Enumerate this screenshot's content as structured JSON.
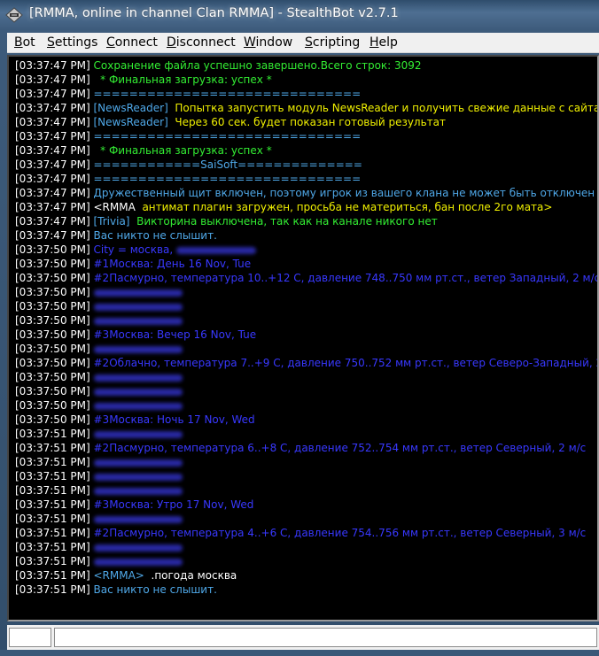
{
  "window": {
    "title": "[RMMA, online in channel Clan RMMA] - StealthBot v2.7.1"
  },
  "menu": [
    {
      "mnemonic": "B",
      "rest": "ot"
    },
    {
      "mnemonic": "S",
      "rest": "ettings"
    },
    {
      "mnemonic": "C",
      "rest": "onnect"
    },
    {
      "mnemonic": "D",
      "rest": "isconnect"
    },
    {
      "mnemonic": "W",
      "rest": "indow"
    },
    {
      "mnemonic": "S",
      "rest": "cripting"
    },
    {
      "mnemonic": "H",
      "rest": "elp"
    }
  ],
  "colors": {
    "green": "#33ee33",
    "yellow": "#f0f000",
    "cyan": "#4fa8e8",
    "blue": "#3838ff",
    "white": "#ffffff"
  },
  "chat": [
    {
      "ts": "[03:37:47 PM]",
      "parts": [
        {
          "t": "Сохранение файла успешно завершено.Всего строк: 3092",
          "c": "green"
        }
      ]
    },
    {
      "ts": "[03:37:47 PM]",
      "parts": [
        {
          "t": "  * Финальная загрузка: успех *",
          "c": "green"
        }
      ]
    },
    {
      "ts": "[03:37:47 PM]",
      "parts": [
        {
          "t": "==============================",
          "c": "cyan"
        }
      ]
    },
    {
      "ts": "[03:37:47 PM]",
      "parts": [
        {
          "t": "[NewsReader]",
          "c": "cyan"
        },
        {
          "t": "  Попытка запустить модуль NewsReader и получить свежие данные с сайта",
          "c": "yellow"
        }
      ]
    },
    {
      "ts": "[03:37:47 PM]",
      "parts": [
        {
          "t": "[NewsReader]",
          "c": "cyan"
        },
        {
          "t": "  Через 60 сек. будет показан готовый результат",
          "c": "yellow"
        }
      ]
    },
    {
      "ts": "[03:37:47 PM]",
      "parts": [
        {
          "t": "==============================",
          "c": "cyan"
        }
      ]
    },
    {
      "ts": "[03:37:47 PM]",
      "parts": [
        {
          "t": "  * Финальная загрузка: успех *",
          "c": "green"
        }
      ]
    },
    {
      "ts": "[03:37:47 PM]",
      "parts": [
        {
          "t": "============SaiSoft==============",
          "c": "cyan"
        }
      ]
    },
    {
      "ts": "[03:37:47 PM]",
      "parts": [
        {
          "t": "==============================",
          "c": "cyan"
        }
      ]
    },
    {
      "ts": "[03:37:47 PM]",
      "parts": [
        {
          "t": "Дружественный щит включен, поэтому игрок из вашего клана не может быть отключен с канала",
          "c": "cyan"
        }
      ]
    },
    {
      "ts": "[03:37:47 PM]",
      "parts": [
        {
          "t": "<RMMA  ",
          "c": "white"
        },
        {
          "t": "антимат плагин загружен, просьба не материться, бан после 2го мата>",
          "c": "yellow"
        }
      ]
    },
    {
      "ts": "[03:37:47 PM]",
      "parts": [
        {
          "t": "[Trivia]",
          "c": "cyan"
        },
        {
          "t": "  Викторина выключена, так как на канале никого нет",
          "c": "green"
        }
      ]
    },
    {
      "ts": "[03:37:47 PM]",
      "parts": [
        {
          "t": "Вас никто не слышит.",
          "c": "cyan"
        }
      ]
    },
    {
      "ts": "[03:37:50 PM]",
      "parts": [
        {
          "t": "City = москва, ",
          "c": "blue"
        }
      ],
      "blur": 90
    },
    {
      "ts": "[03:37:50 PM]",
      "parts": [
        {
          "t": "#1Москва: День 16 Nov, Tue",
          "c": "blue"
        }
      ]
    },
    {
      "ts": "[03:37:50 PM]",
      "parts": [
        {
          "t": "#2Пасмурно, температура 10..+12 С, давление 748..750 мм рт.ст., ветер Западный, 2 м/с",
          "c": "blue"
        }
      ]
    },
    {
      "ts": "[03:37:50 PM]",
      "parts": [],
      "blur": 100
    },
    {
      "ts": "[03:37:50 PM]",
      "parts": [],
      "blur": 100
    },
    {
      "ts": "[03:37:50 PM]",
      "parts": [],
      "blur": 100
    },
    {
      "ts": "[03:37:50 PM]",
      "parts": [
        {
          "t": "#3Москва: Вечер 16 Nov, Tue",
          "c": "blue"
        }
      ]
    },
    {
      "ts": "[03:37:50 PM]",
      "parts": [],
      "blur": 100
    },
    {
      "ts": "[03:37:50 PM]",
      "parts": [
        {
          "t": "#2Облачно, температура 7..+9 С, давление 750..752 мм рт.ст., ветер Северо-Западный, 2 м/с",
          "c": "blue"
        }
      ]
    },
    {
      "ts": "[03:37:50 PM]",
      "parts": [],
      "blur": 100
    },
    {
      "ts": "[03:37:50 PM]",
      "parts": [],
      "blur": 100
    },
    {
      "ts": "[03:37:50 PM]",
      "parts": [],
      "blur": 100
    },
    {
      "ts": "[03:37:50 PM]",
      "parts": [
        {
          "t": "#3Москва: Ночь 17 Nov, Wed",
          "c": "blue"
        }
      ]
    },
    {
      "ts": "[03:37:51 PM]",
      "parts": [],
      "blur": 100
    },
    {
      "ts": "[03:37:51 PM]",
      "parts": [
        {
          "t": "#2Пасмурно, температура 6..+8 С, давление 752..754 мм рт.ст., ветер Северный, 2 м/с",
          "c": "blue"
        }
      ]
    },
    {
      "ts": "[03:37:51 PM]",
      "parts": [],
      "blur": 100
    },
    {
      "ts": "[03:37:51 PM]",
      "parts": [],
      "blur": 100
    },
    {
      "ts": "[03:37:51 PM]",
      "parts": [],
      "blur": 100
    },
    {
      "ts": "[03:37:51 PM]",
      "parts": [
        {
          "t": "#3Москва: Утро 17 Nov, Wed",
          "c": "blue"
        }
      ]
    },
    {
      "ts": "[03:37:51 PM]",
      "parts": [],
      "blur": 100
    },
    {
      "ts": "[03:37:51 PM]",
      "parts": [
        {
          "t": "#2Пасмурно, температура 4..+6 С, давление 754..756 мм рт.ст., ветер Северный, 3 м/с",
          "c": "blue"
        }
      ]
    },
    {
      "ts": "[03:37:51 PM]",
      "parts": [],
      "blur": 100
    },
    {
      "ts": "[03:37:51 PM]",
      "parts": [],
      "blur": 100
    },
    {
      "ts": "[03:37:51 PM]",
      "parts": [
        {
          "t": "<RMMA>",
          "c": "cyan"
        },
        {
          "t": "  .погода москва",
          "c": "white"
        }
      ]
    },
    {
      "ts": "[03:37:51 PM]",
      "parts": [
        {
          "t": "Вас никто не слышит.",
          "c": "cyan"
        }
      ]
    }
  ],
  "status": {
    "cell1": "",
    "cell2": ""
  }
}
